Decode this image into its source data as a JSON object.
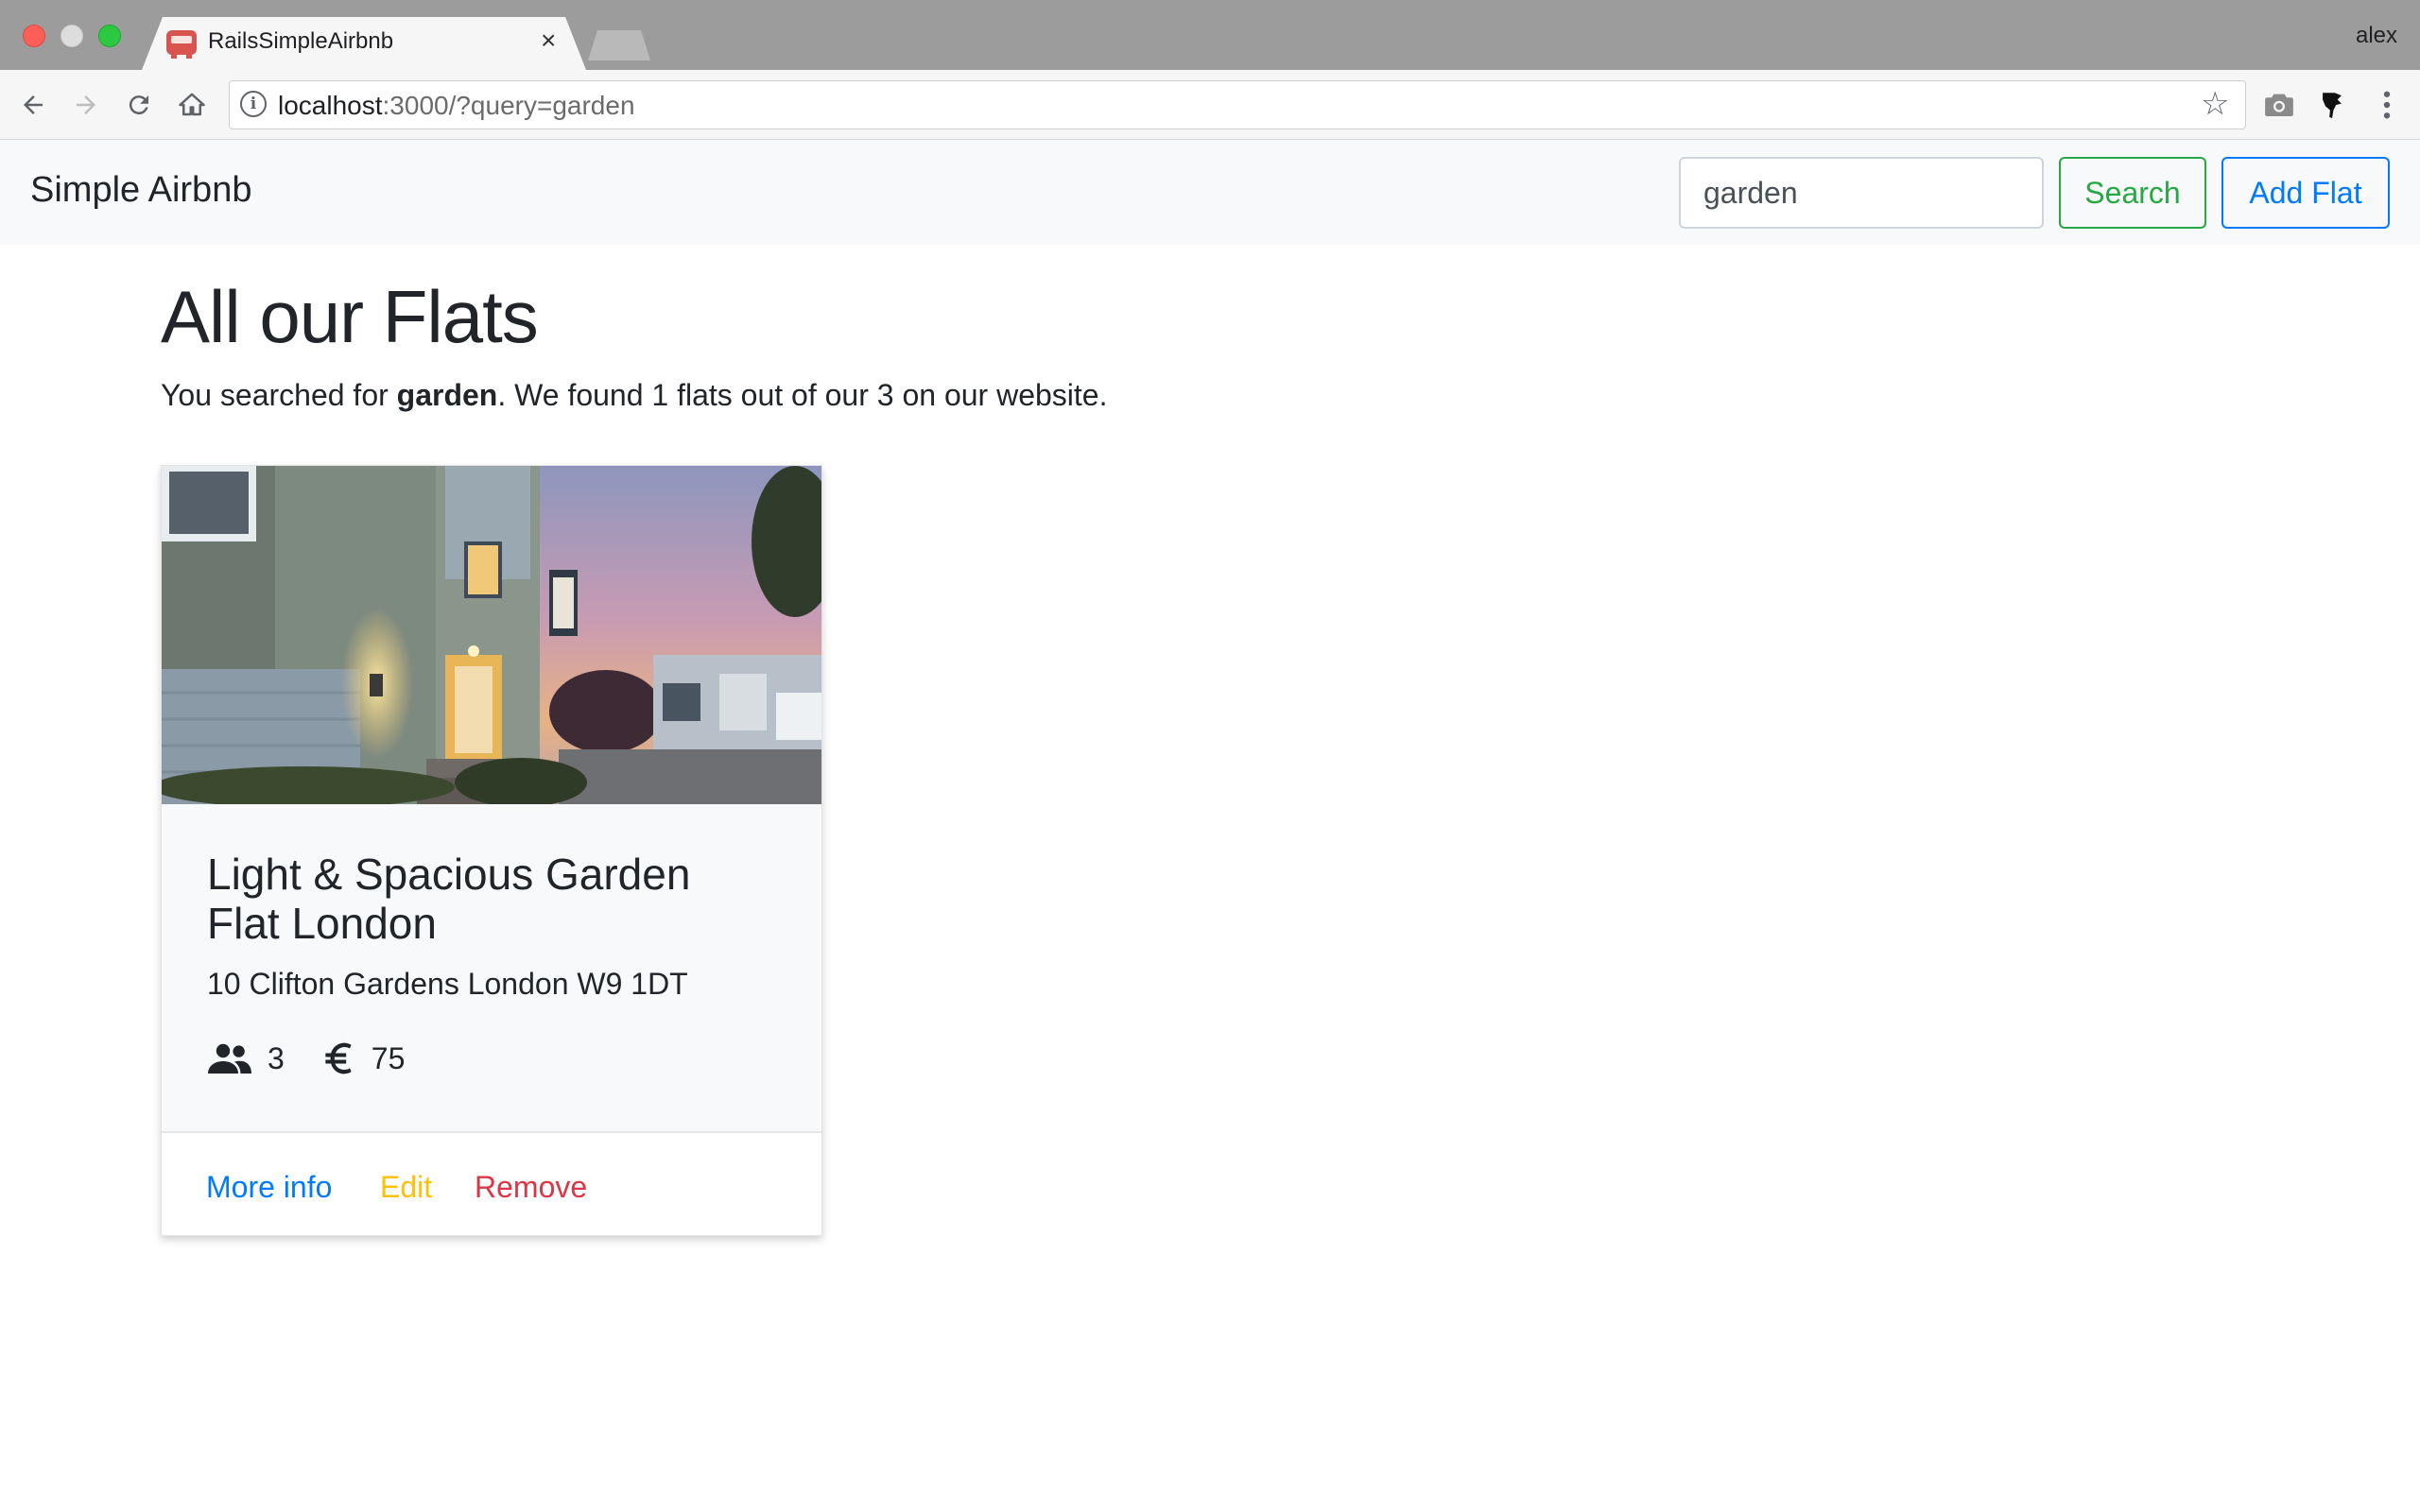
{
  "browser": {
    "tab_title": "RailsSimpleAirbnb",
    "tab_close": "×",
    "profile_name": "alex",
    "url_host": "localhost",
    "url_rest": ":3000/?query=garden"
  },
  "navbar": {
    "brand": "Simple Airbnb",
    "search_value": "garden",
    "search_button": "Search",
    "add_button": "Add Flat"
  },
  "main": {
    "heading": "All our Flats",
    "summary_prefix": "You searched for ",
    "summary_query": "garden",
    "summary_suffix": ". We found 1 flats out of our 3 on our website."
  },
  "flats": [
    {
      "name": "Light & Spacious Garden Flat London",
      "address": "10 Clifton Gardens London W9 1DT",
      "guests": "3",
      "price": "75",
      "links": {
        "more_info": "More info",
        "edit": "Edit",
        "remove": "Remove"
      }
    }
  ],
  "icons": {
    "guests": "people-icon",
    "price": "euro-icon"
  },
  "colors": {
    "primary": "#007bff",
    "success": "#28a745",
    "warning": "#ffc107",
    "danger": "#dc3545"
  }
}
